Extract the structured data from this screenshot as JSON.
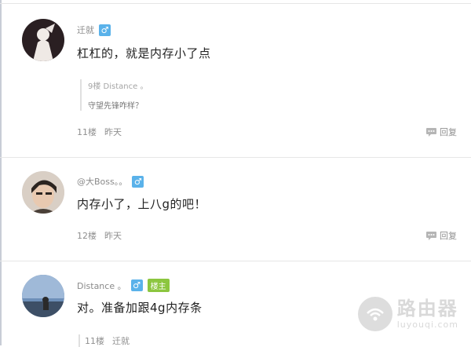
{
  "colors": {
    "gender_badge": "#5ab2ea",
    "owner_badge": "#8cc63f",
    "divider": "#e6e6e6"
  },
  "comments": [
    {
      "username": "迁就",
      "gender_icon": "♂",
      "text": "杠杠的，就是内存小了点",
      "quote": {
        "meta": "9楼   Distance 。",
        "text": "守望先锋咋样？"
      },
      "floor": "11楼",
      "time": "昨天",
      "reply_label": "回复"
    },
    {
      "username": "@大Boss。。",
      "gender_icon": "♂",
      "text": "内存小了，上八g的吧！",
      "floor": "12楼",
      "time": "昨天",
      "reply_label": "回复"
    },
    {
      "username": "Distance 。",
      "gender_icon": "♂",
      "owner_badge": "楼主",
      "text": "对。准备加跟4g内存条",
      "floor": "11楼",
      "time": "迁就"
    }
  ],
  "watermark": {
    "cn": "路由器",
    "en": "luyouqi.com"
  }
}
